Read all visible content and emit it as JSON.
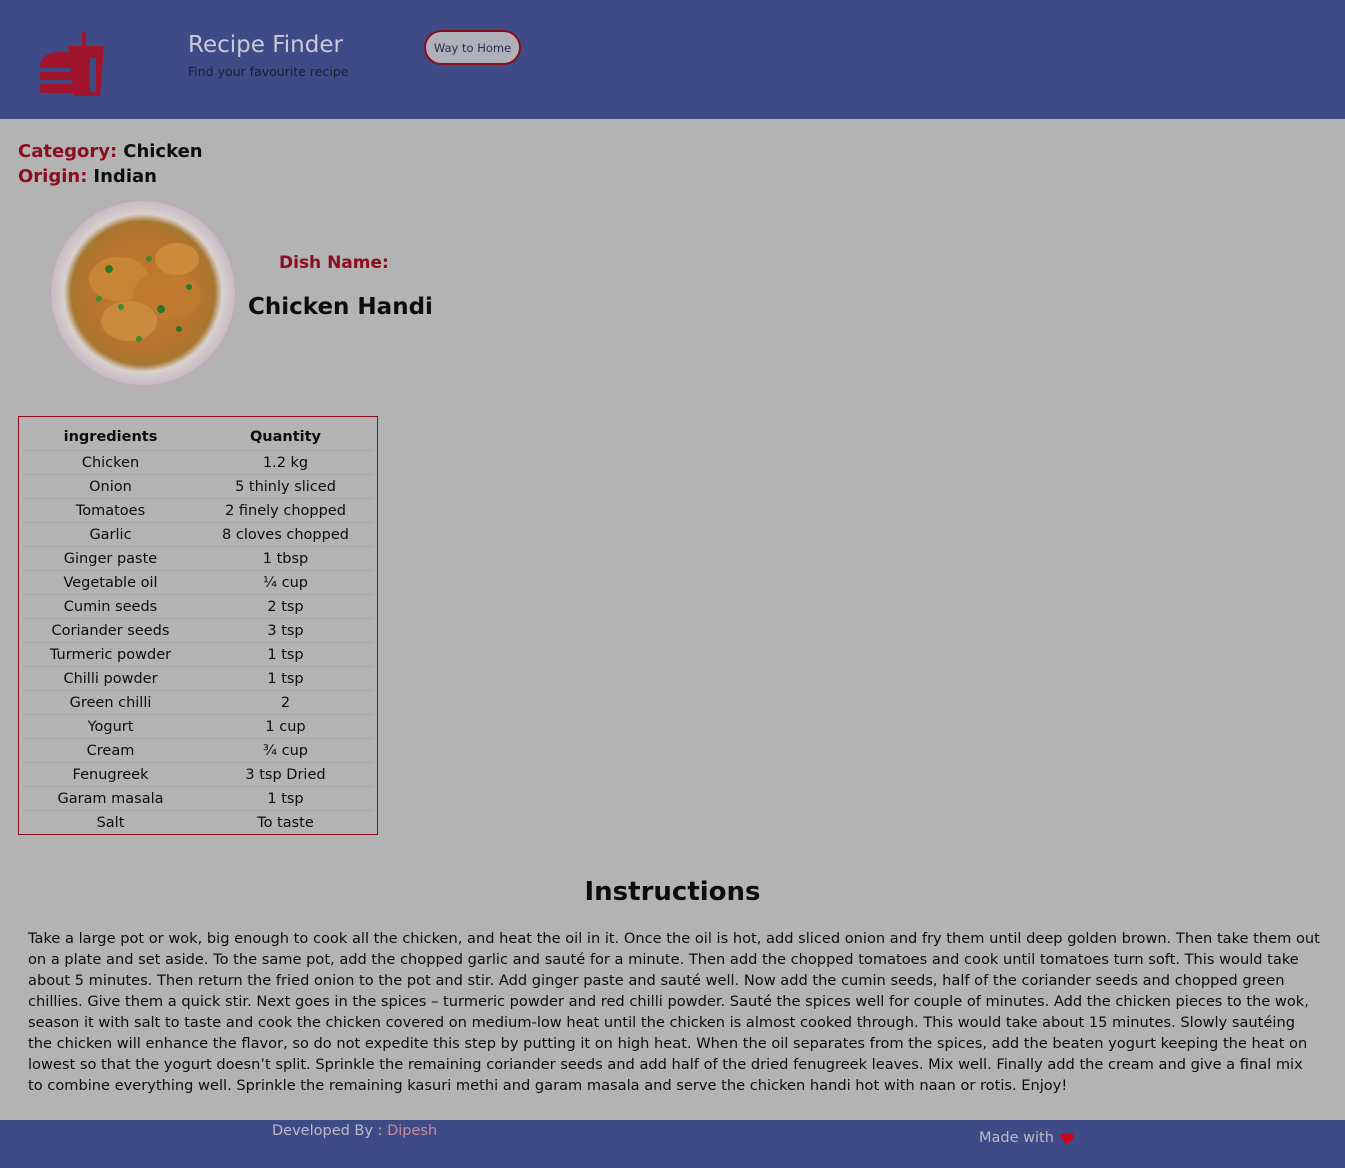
{
  "header": {
    "title": "Recipe Finder",
    "subtitle": "Find your favourite recipe",
    "home_button": "Way to Home"
  },
  "meta": {
    "category_label": "Category:",
    "category_value": "Chicken",
    "origin_label": "Origin:",
    "origin_value": "Indian"
  },
  "dish": {
    "label": "Dish Name:",
    "name": "Chicken Handi"
  },
  "ingredients": {
    "headers": [
      "ingredients",
      "Quantity"
    ],
    "rows": [
      [
        "Chicken",
        "1.2 kg"
      ],
      [
        "Onion",
        "5 thinly sliced"
      ],
      [
        "Tomatoes",
        "2 finely chopped"
      ],
      [
        "Garlic",
        "8 cloves chopped"
      ],
      [
        "Ginger paste",
        "1 tbsp"
      ],
      [
        "Vegetable oil",
        "¼ cup"
      ],
      [
        "Cumin seeds",
        "2 tsp"
      ],
      [
        "Coriander seeds",
        "3 tsp"
      ],
      [
        "Turmeric powder",
        "1 tsp"
      ],
      [
        "Chilli powder",
        "1 tsp"
      ],
      [
        "Green chilli",
        "2"
      ],
      [
        "Yogurt",
        "1 cup"
      ],
      [
        "Cream",
        "¾ cup"
      ],
      [
        "Fenugreek",
        "3 tsp Dried"
      ],
      [
        "Garam masala",
        "1 tsp"
      ],
      [
        "Salt",
        "To taste"
      ]
    ]
  },
  "instructions": {
    "title": "Instructions",
    "text": "Take a large pot or wok, big enough to cook all the chicken, and heat the oil in it. Once the oil is hot, add sliced onion and fry them until deep golden brown. Then take them out on a plate and set aside. To the same pot, add the chopped garlic and sauté for a minute. Then add the chopped tomatoes and cook until tomatoes turn soft. This would take about 5 minutes. Then return the fried onion to the pot and stir. Add ginger paste and sauté well. Now add the cumin seeds, half of the coriander seeds and chopped green chillies. Give them a quick stir. Next goes in the spices – turmeric powder and red chilli powder. Sauté the spices well for couple of minutes. Add the chicken pieces to the wok, season it with salt to taste and cook the chicken covered on medium-low heat until the chicken is almost cooked through. This would take about 15 minutes. Slowly sautéing the chicken will enhance the flavor, so do not expedite this step by putting it on high heat. When the oil separates from the spices, add the beaten yogurt keeping the heat on lowest so that the yogurt doesn’t split. Sprinkle the remaining coriander seeds and add half of the dried fenugreek leaves. Mix well. Finally add the cream and give a final mix to combine everything well. Sprinkle the remaining kasuri methi and garam masala and serve the chicken handi hot with naan or rotis. Enjoy!"
  },
  "footer": {
    "developed_label": "Developed By : ",
    "developer": "Dipesh",
    "made_with": "Made with"
  },
  "colors": {
    "header_bg": "#3f4b87",
    "page_bg": "#b3b3b3",
    "accent": "#8a0d20",
    "heart": "#d0021b"
  },
  "icons": {
    "logo": "burger-drink-logo-icon",
    "heart": "heart-icon"
  }
}
